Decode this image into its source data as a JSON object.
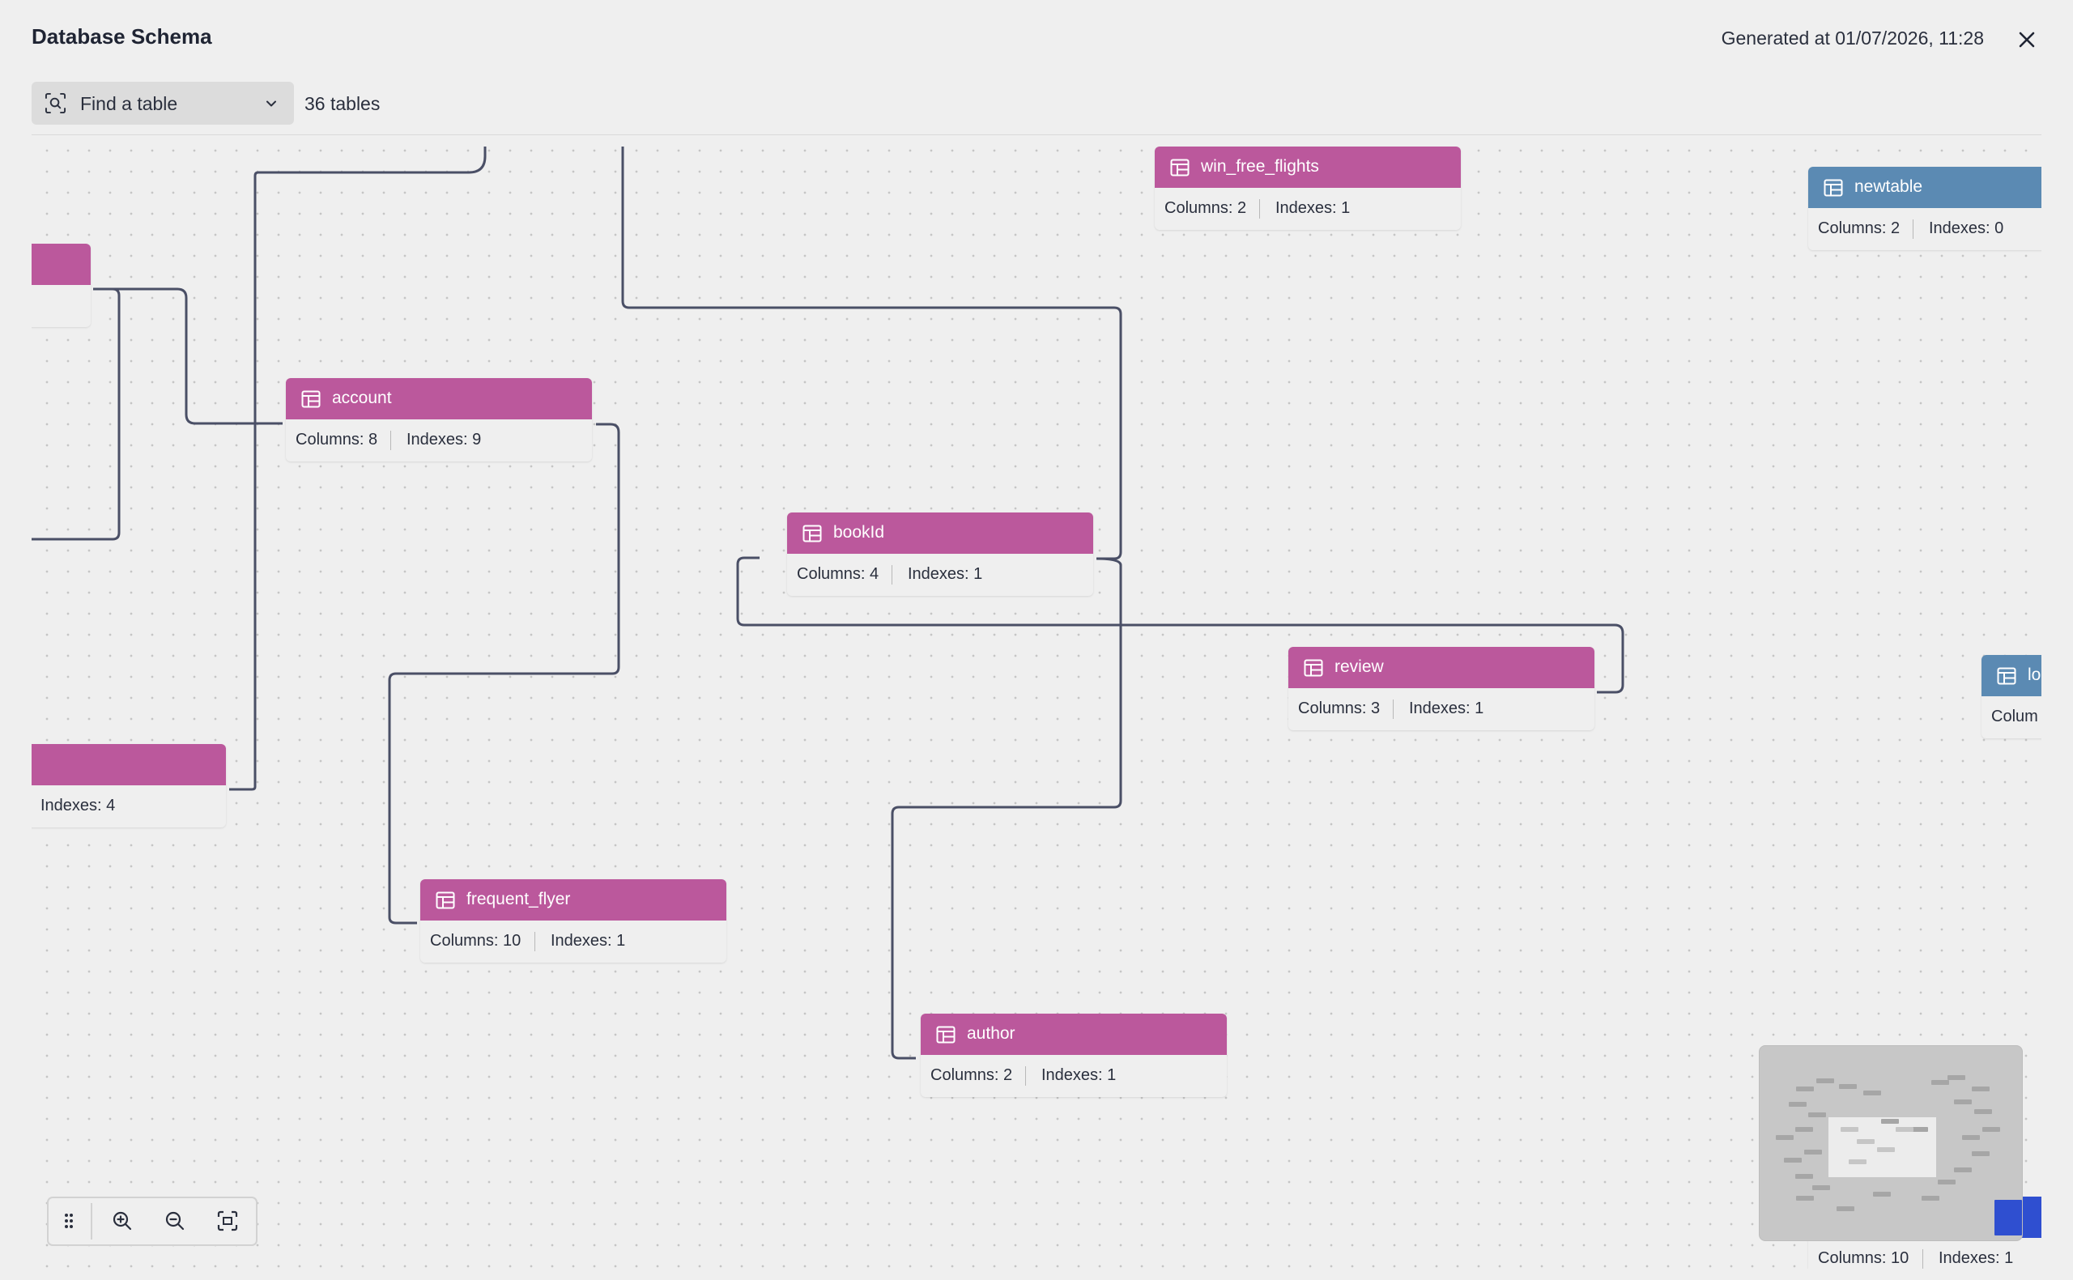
{
  "header": {
    "title": "Database Schema",
    "generated": "Generated at 01/07/2026, 11:28"
  },
  "toolbar": {
    "search_placeholder": "Find a table",
    "table_count": "36 tables"
  },
  "tables": {
    "win_free_flights": {
      "name": "win_free_flights",
      "columns": "Columns: 2",
      "indexes": "Indexes: 1"
    },
    "newtable": {
      "name": "newtable",
      "columns": "Columns: 2",
      "indexes": "Indexes: 0"
    },
    "account": {
      "name": "account",
      "columns": "Columns: 8",
      "indexes": "Indexes: 9"
    },
    "bookId": {
      "name": "bookId",
      "columns": "Columns: 4",
      "indexes": "Indexes: 1"
    },
    "review": {
      "name": "review",
      "columns": "Columns: 3",
      "indexes": "Indexes: 1"
    },
    "frequent_flyer": {
      "name": "frequent_flyer",
      "columns": "Columns: 10",
      "indexes": "Indexes: 1"
    },
    "author": {
      "name": "author",
      "columns": "Columns: 2",
      "indexes": "Indexes: 1"
    },
    "partial_left_lower": {
      "indexes": "Indexes: 4"
    },
    "partial_right": {
      "name": "lo",
      "columns": "Colum"
    },
    "partial_bottom_right": {
      "columns": "Columns: 10",
      "indexes": "Indexes: 1"
    }
  },
  "colors": {
    "table_header": "#bb589c",
    "table_header_alt": "#5b8ab3",
    "edge": "#4a4f66",
    "minimap_accent": "#2f4fd0"
  },
  "icons": {
    "close": "close-icon",
    "search": "scan-search-icon",
    "dropdown": "chevron-down-icon",
    "table": "table-icon",
    "drag": "drag-handle-icon",
    "zoom_in": "zoom-in-icon",
    "zoom_out": "zoom-out-icon",
    "fit": "fit-view-icon"
  }
}
